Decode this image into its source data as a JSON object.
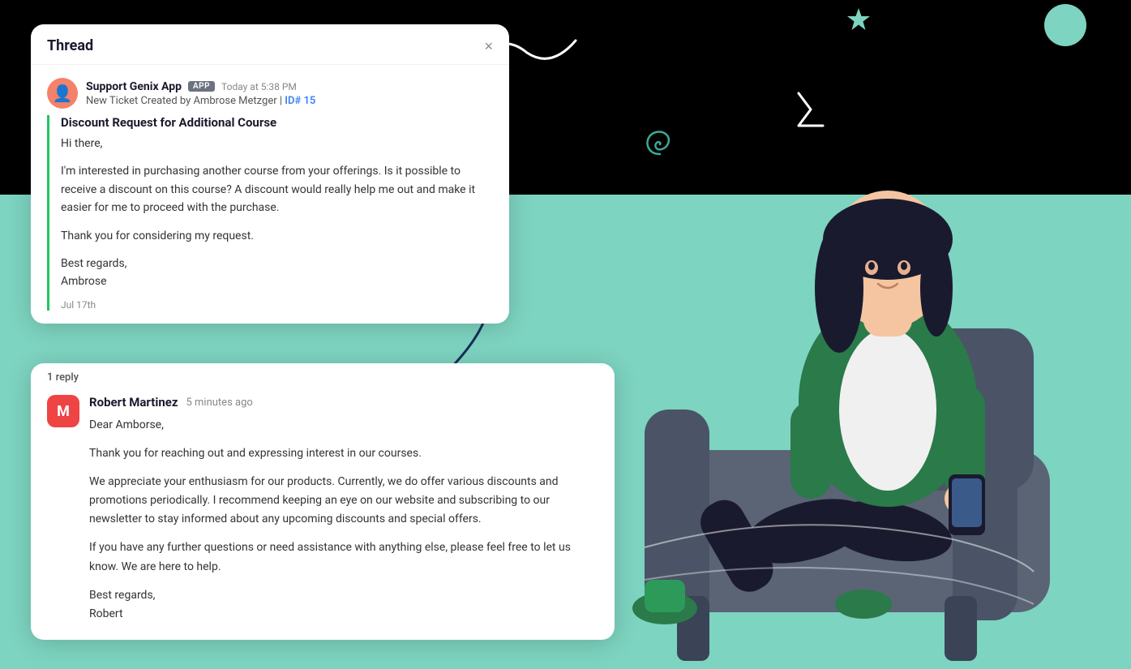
{
  "page": {
    "background_top": "#000000",
    "background_bottom": "#7dd4c0"
  },
  "thread": {
    "title": "Thread",
    "close_label": "×",
    "message": {
      "sender": "Support Genix App",
      "badge": "APP",
      "time": "Today at 5:38 PM",
      "subtitle_pre": "New Ticket Created by Ambrose Metzger |",
      "ticket_id": "ID# 15",
      "subject": "Discount Request for Additional Course",
      "greeting": "Hi there,",
      "body1": "I'm interested in purchasing another course from your offerings. Is it possible to receive a discount on this course? A discount would really help me out and make it easier for me to proceed with the purchase.",
      "body2": "Thank you for considering my request.",
      "closing": "Best regards,",
      "signer": "Ambrose",
      "date": "Jul 17th"
    }
  },
  "reply_section": {
    "reply_count": "1 reply",
    "reply": {
      "sender": "Robert Martinez",
      "avatar_letter": "M",
      "time": "5 minutes ago",
      "greeting": "Dear Amborse,",
      "body1": "Thank you for reaching out and expressing interest in our courses.",
      "body2": "We appreciate your enthusiasm for our products. Currently, we do offer various discounts and promotions periodically. I recommend keeping an eye on our website and subscribing to our newsletter to stay informed about any upcoming discounts and special offers.",
      "body3": "If you have any further questions or need assistance with anything else, please feel free to let us know. We are here to help.",
      "closing": "Best regards,",
      "signer": "Robert"
    }
  }
}
